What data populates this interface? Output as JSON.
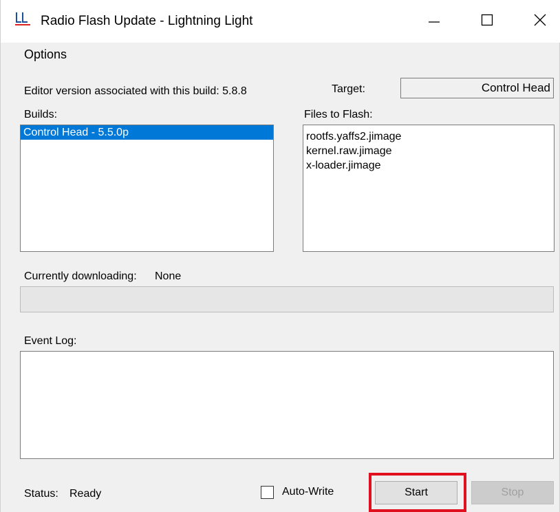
{
  "window": {
    "title": "Radio Flash Update - Lightning Light",
    "icon": "lightning-light-logo-icon",
    "controls": [
      "minimize-icon",
      "maximize-icon",
      "close-icon"
    ]
  },
  "menu": {
    "options_label": "Options"
  },
  "editor_version_label": "Editor version associated with this build: 5.8.8",
  "target": {
    "label": "Target:",
    "value": "Control Head"
  },
  "builds": {
    "label": "Builds:",
    "items": [
      {
        "label": "Control Head - 5.5.0p",
        "selected": true
      }
    ]
  },
  "files": {
    "label": "Files to Flash:",
    "items": [
      "rootfs.yaffs2.jimage",
      "kernel.raw.jimage",
      "x-loader.jimage"
    ]
  },
  "download": {
    "label": "Currently downloading:",
    "value": "None",
    "progress": 0
  },
  "event_log": {
    "label": "Event Log:"
  },
  "status": {
    "label": "Status:",
    "value": "Ready"
  },
  "auto_write": {
    "label": "Auto-Write",
    "checked": false
  },
  "buttons": {
    "start": "Start",
    "stop": "Stop"
  },
  "colors": {
    "selection": "#0078d7",
    "highlight_box": "#e0101e",
    "window_bg": "#f0f0f0"
  }
}
